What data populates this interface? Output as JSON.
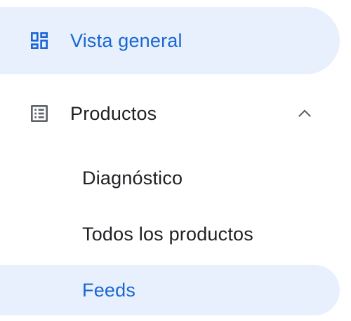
{
  "nav": {
    "overview": {
      "label": "Vista general",
      "icon": "dashboard-icon"
    },
    "products": {
      "label": "Productos",
      "icon": "list-alt-icon",
      "expand_icon": "chevron-up-icon",
      "expanded": true
    },
    "sub_items": [
      {
        "label": "Diagnóstico"
      },
      {
        "label": "Todos los productos"
      },
      {
        "label": "Feeds"
      }
    ]
  },
  "colors": {
    "active_bg": "#e8f0fe",
    "active_text": "#1967d2",
    "text": "#202124",
    "icon": "#5f6368"
  }
}
